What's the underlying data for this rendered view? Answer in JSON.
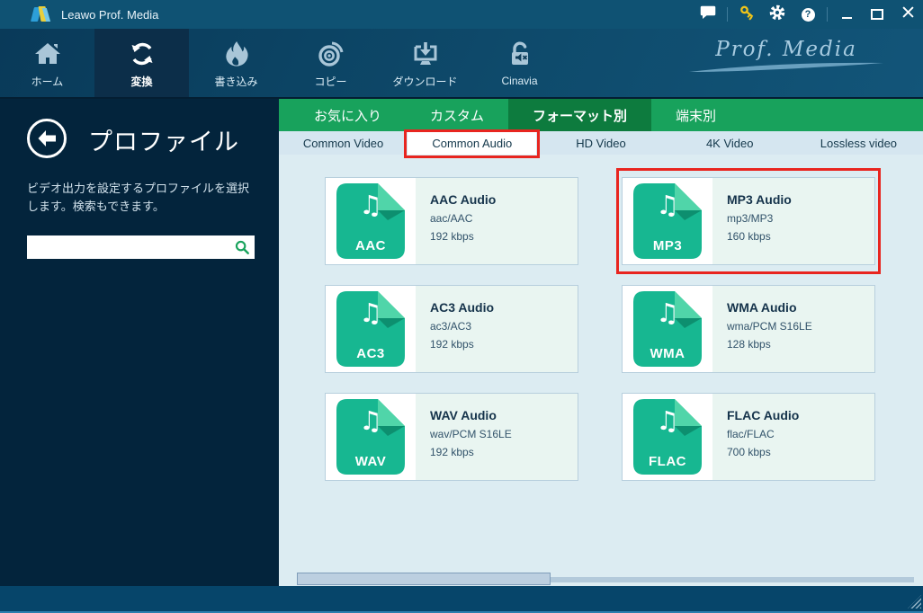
{
  "titlebar": {
    "app_title": "Leawo Prof. Media"
  },
  "nav": {
    "brand_script": "Prof. Media",
    "items": [
      {
        "label": "ホーム",
        "selected": false
      },
      {
        "label": "変換",
        "selected": true
      },
      {
        "label": "書き込み",
        "selected": false
      },
      {
        "label": "コピー",
        "selected": false
      },
      {
        "label": "ダウンロード",
        "selected": false
      },
      {
        "label": "Cinavia",
        "selected": false
      }
    ]
  },
  "sidebar": {
    "title": "プロファイル",
    "description": "ビデオ出力を設定するプロファイルを選択します。検索もできます。",
    "search_value": ""
  },
  "category_tabs": {
    "items": [
      {
        "label": "お気に入り",
        "selected": false
      },
      {
        "label": "カスタム",
        "selected": false
      },
      {
        "label": "フォーマット別",
        "selected": true
      },
      {
        "label": "端末別",
        "selected": false
      }
    ]
  },
  "format_tabs": {
    "items": [
      {
        "label": "Common Video",
        "selected": false,
        "annotated": false
      },
      {
        "label": "Common Audio",
        "selected": true,
        "annotated": true
      },
      {
        "label": "HD Video",
        "selected": false,
        "annotated": false
      },
      {
        "label": "4K Video",
        "selected": false,
        "annotated": false
      },
      {
        "label": "Lossless video",
        "selected": false,
        "annotated": false
      }
    ]
  },
  "profiles": [
    {
      "badge": "AAC",
      "title": "AAC Audio",
      "codec": "aac/AAC",
      "bitrate": "192 kbps",
      "annotated": false
    },
    {
      "badge": "MP3",
      "title": "MP3 Audio",
      "codec": "mp3/MP3",
      "bitrate": "160 kbps",
      "annotated": true
    },
    {
      "badge": "AC3",
      "title": "AC3 Audio",
      "codec": "ac3/AC3",
      "bitrate": "192 kbps",
      "annotated": false
    },
    {
      "badge": "WMA",
      "title": "WMA Audio",
      "codec": "wma/PCM S16LE",
      "bitrate": "128 kbps",
      "annotated": false
    },
    {
      "badge": "WAV",
      "title": "WAV Audio",
      "codec": "wav/PCM S16LE",
      "bitrate": "192 kbps",
      "annotated": false
    },
    {
      "badge": "FLAC",
      "title": "FLAC Audio",
      "codec": "flac/FLAC",
      "bitrate": "700 kbps",
      "annotated": false
    }
  ],
  "colors": {
    "accent_green": "#18a25c",
    "selected_green": "#0d7b3e",
    "annotation_red": "#e8251f",
    "format_icon_teal": "#17b791",
    "titlebar_blue": "#0f5273",
    "sidebar_navy": "#03243c",
    "content_bg": "#dcecf2"
  }
}
